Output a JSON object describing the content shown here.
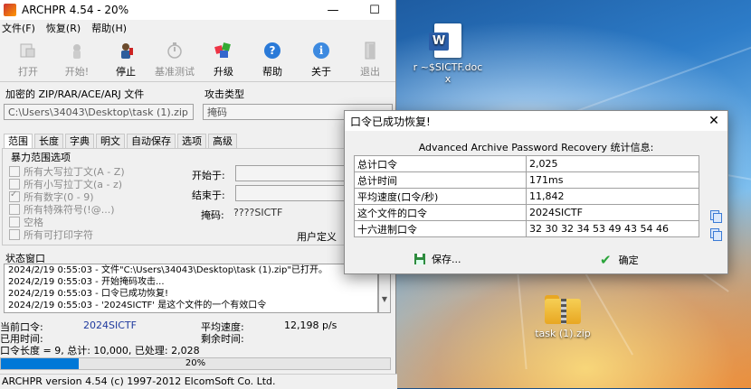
{
  "window": {
    "title": "ARCHPR 4.54 - 20%",
    "controls": {
      "minimize": "—",
      "maximize": "☐"
    }
  },
  "menu": [
    "文件(F)",
    "恢复(R)",
    "帮助(H)"
  ],
  "toolbar": [
    {
      "label": "打开",
      "icon": "open-icon",
      "enabled": false
    },
    {
      "label": "开始!",
      "icon": "start-icon",
      "enabled": false
    },
    {
      "label": "停止",
      "icon": "stop-icon",
      "enabled": true
    },
    {
      "label": "基准测试",
      "icon": "benchmark-stopwatch-icon",
      "enabled": false
    },
    {
      "label": "升级",
      "icon": "upgrade-icon",
      "enabled": true
    },
    {
      "label": "帮助",
      "icon": "help-icon",
      "enabled": true
    },
    {
      "label": "关于",
      "icon": "about-icon",
      "enabled": true
    },
    {
      "label": "退出",
      "icon": "exit-door-icon",
      "enabled": false
    }
  ],
  "encrypted_file": {
    "label": "加密的 ZIP/RAR/ACE/ARJ 文件",
    "value": "C:\\Users\\34043\\Desktop\\task (1).zip"
  },
  "attack_type": {
    "label": "攻击类型",
    "value": "掩码"
  },
  "tabs": [
    "范围",
    "长度",
    "字典",
    "明文",
    "自动保存",
    "选项",
    "高级"
  ],
  "active_tab": "范围",
  "range": {
    "group_label": "暴力范围选项",
    "options": [
      {
        "label": "所有大写拉丁文(A - Z)",
        "checked": false
      },
      {
        "label": "所有小写拉丁文(a - z)",
        "checked": false
      },
      {
        "label": "所有数字(0 - 9)",
        "checked": true
      },
      {
        "label": "所有特殊符号(!@...)",
        "checked": false
      },
      {
        "label": "空格",
        "checked": false
      },
      {
        "label": "所有可打印字符",
        "checked": false
      }
    ],
    "start_label": "开始于:",
    "end_label": "结束于:",
    "mask_label": "掩码:",
    "mask_value": "????SICTF",
    "user_defined_label": "用户定义"
  },
  "status": {
    "label": "状态窗口",
    "log": [
      "2024/2/19 0:55:03 - 文件\"C:\\Users\\34043\\Desktop\\task (1).zip\"已打开。",
      "2024/2/19 0:55:03 - 开始掩码攻击...",
      "2024/2/19 0:55:03 - 口令已成功恢复!",
      "2024/2/19 0:55:03 - '2024SICTF' 是这个文件的一个有效口令"
    ],
    "current_password_label": "当前口令:",
    "current_password": "2024SICTF",
    "avg_speed_label": "平均速度:",
    "avg_speed": "12,198 p/s",
    "elapsed_label": "已用时间:",
    "remaining_label": "剩余时间:",
    "summary": "口令长度 = 9, 总计: 10,000, 已处理: 2,028"
  },
  "progress": {
    "text": "20%",
    "value": 0.2
  },
  "statusbar": "ARCHPR version 4.54 (c) 1997-2012 ElcomSoft Co. Ltd.",
  "dialog": {
    "title": "口令已成功恢复!",
    "close": "✕",
    "heading": "Advanced Archive Password Recovery 统计信息:",
    "rows": [
      {
        "key": "总计口令",
        "value": "2,025"
      },
      {
        "key": "总计时间",
        "value": "171ms"
      },
      {
        "key": "平均速度(口令/秒)",
        "value": "11,842"
      },
      {
        "key": "这个文件的口令",
        "value": "2024SICTF"
      },
      {
        "key": "十六进制口令",
        "value": "32 30 32 34 53 49 43 54 46"
      }
    ],
    "save_label": "保存...",
    "ok_label": "确定"
  },
  "desktop": {
    "word_file": "~$SICTF.doc",
    "word_file_prefix": "r",
    "word_file_suffix": "x",
    "zip_file": "task (1).zip"
  },
  "colors": {
    "accent": "#0078d7",
    "word_blue": "#2b5ea8",
    "zip_yellow": "#f6cf55"
  }
}
